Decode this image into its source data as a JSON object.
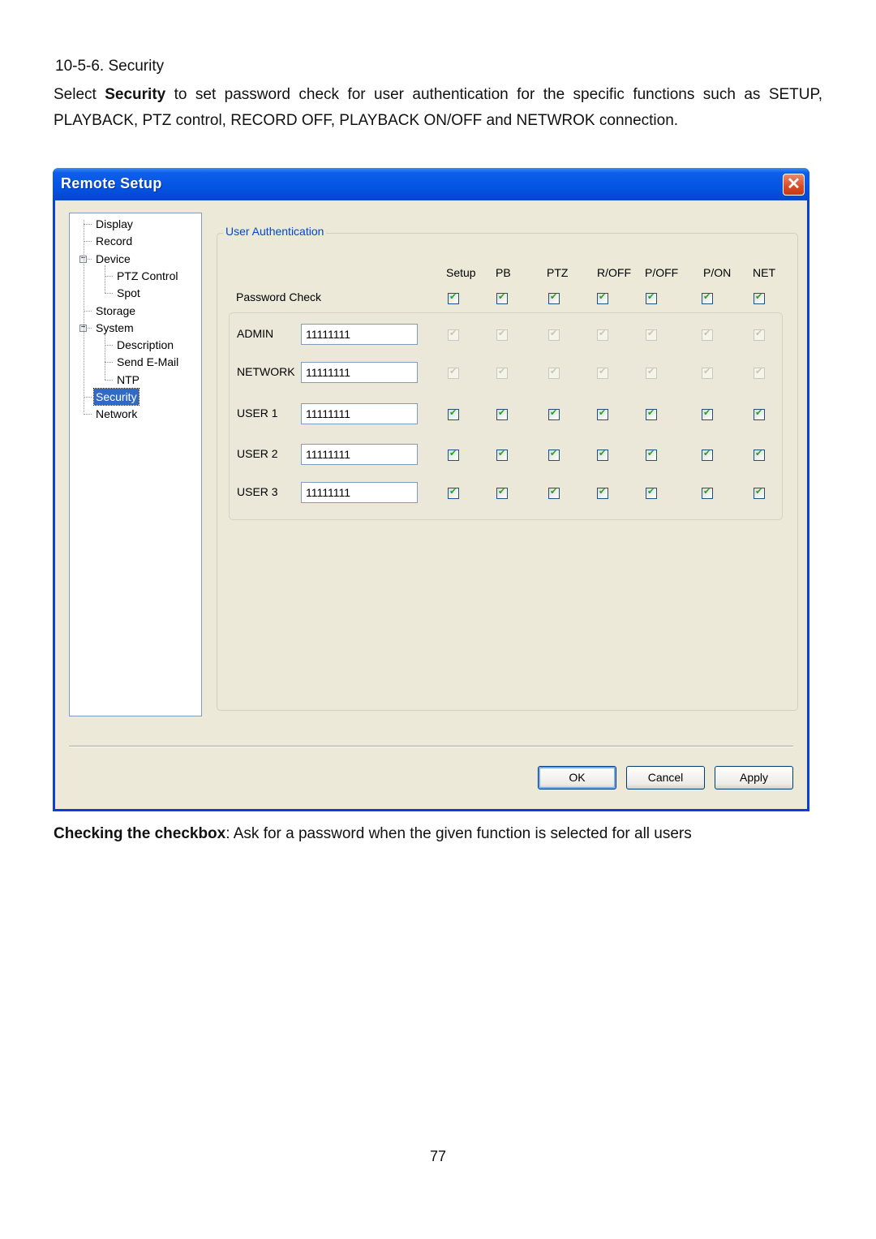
{
  "doc": {
    "heading": "10-5-6. Security",
    "intro_pre": "Select ",
    "intro_bold": "Security",
    "intro_post": " to set password check for user authentication for the specific functions such as SETUP, PLAYBACK, PTZ control, RECORD OFF, PLAYBACK ON/OFF and NETWROK connection.",
    "note_bold": "Checking the checkbox",
    "note_text": ": Ask for a password when the given function is selected for all users",
    "page_number": "77"
  },
  "window": {
    "title": "Remote Setup",
    "close_icon": "close-icon"
  },
  "tree": {
    "items": [
      {
        "label": "Display",
        "level": 0
      },
      {
        "label": "Record",
        "level": 0
      },
      {
        "label": "Device",
        "level": 0,
        "expanded": true
      },
      {
        "label": "PTZ Control",
        "level": 1
      },
      {
        "label": "Spot",
        "level": 1
      },
      {
        "label": "Storage",
        "level": 0
      },
      {
        "label": "System",
        "level": 0,
        "expanded": true
      },
      {
        "label": "Description",
        "level": 1
      },
      {
        "label": "Send E-Mail",
        "level": 1
      },
      {
        "label": "NTP",
        "level": 1
      },
      {
        "label": "Security",
        "level": 0,
        "selected": true
      },
      {
        "label": "Network",
        "level": 0
      }
    ]
  },
  "auth": {
    "group_title": "User Authentication",
    "columns": [
      "Setup",
      "PB",
      "PTZ",
      "R/OFF",
      "P/OFF",
      "P/ON",
      "NET"
    ],
    "password_check_label": "Password Check",
    "password_check": [
      true,
      true,
      true,
      true,
      true,
      true,
      true
    ],
    "users": [
      {
        "name": "ADMIN",
        "password": "11111111",
        "checks": [
          true,
          true,
          true,
          true,
          true,
          true,
          true
        ],
        "disabled": true
      },
      {
        "name": "NETWORK",
        "password": "11111111",
        "checks": [
          true,
          true,
          true,
          true,
          true,
          true,
          true
        ],
        "disabled": true
      },
      {
        "name": "USER 1",
        "password": "11111111",
        "checks": [
          true,
          true,
          true,
          true,
          true,
          true,
          true
        ],
        "disabled": false
      },
      {
        "name": "USER 2",
        "password": "11111111",
        "checks": [
          true,
          true,
          true,
          true,
          true,
          true,
          true
        ],
        "disabled": false
      },
      {
        "name": "USER 3",
        "password": "11111111",
        "checks": [
          true,
          true,
          true,
          true,
          true,
          true,
          true
        ],
        "disabled": false
      }
    ]
  },
  "buttons": {
    "ok": "OK",
    "cancel": "Cancel",
    "apply": "Apply"
  }
}
